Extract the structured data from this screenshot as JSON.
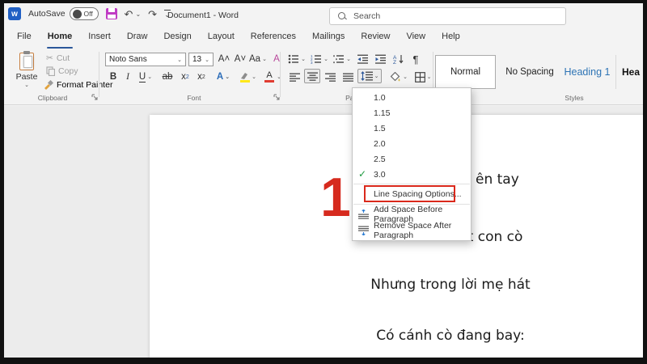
{
  "colors": {
    "accent_blue": "#2b579a",
    "heading_blue": "#2e74b5",
    "annotation_red": "#da291c",
    "check_green": "#1d9a3f",
    "save_magenta": "#c03bc4"
  },
  "titlebar": {
    "autosave_label": "AutoSave",
    "autosave_state": "Off",
    "document_title": "Document1  -  Word",
    "search_placeholder": "Search"
  },
  "menubar": {
    "items": [
      "File",
      "Home",
      "Insert",
      "Draw",
      "Design",
      "Layout",
      "References",
      "Mailings",
      "Review",
      "View",
      "Help"
    ],
    "active_item": "Home"
  },
  "ribbon": {
    "clipboard": {
      "group_label": "Clipboard",
      "paste_label": "Paste",
      "cut_label": "Cut",
      "copy_label": "Copy",
      "format_painter_label": "Format Painter"
    },
    "font": {
      "group_label": "Font",
      "font_name": "Noto Sans",
      "font_size": "13",
      "bold_label": "B",
      "italic_label": "I",
      "underline_label": "U",
      "strikethrough_label": "ab",
      "subscript_label": "x",
      "superscript_label": "x",
      "grow_font_label": "A˄",
      "shrink_font_label": "A˅",
      "change_case_label": "Aa",
      "clear_format_label": "A",
      "text_effects_label": "A",
      "font_color_label": "A"
    },
    "paragraph": {
      "group_label": "Paragraph"
    },
    "styles": {
      "group_label": "Styles",
      "items": [
        "Normal",
        "No Spacing",
        "Heading 1",
        "Hea"
      ],
      "selected": "Normal"
    }
  },
  "spacing_menu": {
    "options": [
      "1.0",
      "1.15",
      "1.5",
      "2.0",
      "2.5",
      "3.0"
    ],
    "checked_option": "3.0",
    "line_spacing_options_label": "Line Spacing Options...",
    "add_space_label": "Add Space Before Paragraph",
    "remove_space_label": "Remove Space After Paragraph"
  },
  "annotation": {
    "step_number": "1"
  },
  "document": {
    "lines": [
      "ên tay",
      "Con chưa biết con cò",
      "Nhưng trong lời mẹ hát",
      "Có cánh cò đang bay:"
    ]
  }
}
